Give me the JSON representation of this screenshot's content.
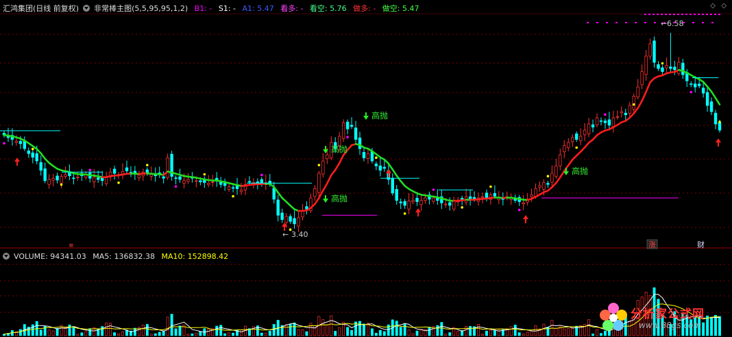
{
  "header": {
    "stock_title": "汇鸿集团(日线 前复权)",
    "indicator_title": "非常棒主图(5,5,95,95,1,2)",
    "b1": "B1: -",
    "s1": "S1: -",
    "a1": "A1: 5.47",
    "kanduo": "看多: -",
    "kankong": "看空: 5.76",
    "zuoduo": "做多: -",
    "zuokong": "做空: 5.47"
  },
  "volume_header": {
    "volume": "VOLUME: 94341.03",
    "ma5": "MA5: 136832.38",
    "ma10": "MA10: 152898.42"
  },
  "annotations": {
    "high_label": "6.58",
    "low_label": "3.40",
    "gaopao": "高抛",
    "zhang_badge": "涨",
    "cai_badge": "财"
  },
  "colors": {
    "up": "#ff3232",
    "down": "#00ffff",
    "line_down": "#22dd22",
    "line_up": "#ff1e1e",
    "grid": "#800000",
    "yellow": "#ffff00",
    "magenta": "#ff00ff"
  },
  "watermark": {
    "text": "分析家公式网",
    "url": "www.88gs.com"
  },
  "chart_data": {
    "type": "candlestick",
    "ylim": [
      3.2,
      6.8
    ],
    "price_high": 6.58,
    "price_low": 3.4,
    "a1": 5.47,
    "closes": [
      4.92,
      4.88,
      4.85,
      4.82,
      4.78,
      4.7,
      4.62,
      4.56,
      4.5,
      4.35,
      4.18,
      4.2,
      4.22,
      4.19,
      4.25,
      4.28,
      4.26,
      4.22,
      4.24,
      4.26,
      4.28,
      4.22,
      4.24,
      4.2,
      4.18,
      4.24,
      4.32,
      4.3,
      4.28,
      4.33,
      4.34,
      4.31,
      4.29,
      4.27,
      4.32,
      4.3,
      4.28,
      4.26,
      4.28,
      4.22,
      4.55,
      4.25,
      4.22,
      4.2,
      4.18,
      4.2,
      4.22,
      4.18,
      4.16,
      4.15,
      4.14,
      4.16,
      4.18,
      4.12,
      4.1,
      4.08,
      4.06,
      4.05,
      4.03,
      4.12,
      4.16,
      4.15,
      4.14,
      4.14,
      4.15,
      4.12,
      3.88,
      3.62,
      3.55,
      3.6,
      3.52,
      3.48,
      3.58,
      3.7,
      3.72,
      3.9,
      4.05,
      4.3,
      4.5,
      4.6,
      4.8,
      4.7,
      4.9,
      5.12,
      5.02,
      5.06,
      4.85,
      4.7,
      4.55,
      4.62,
      4.5,
      4.42,
      4.35,
      4.38,
      4.2,
      3.98,
      3.86,
      3.82,
      3.78,
      3.85,
      3.86,
      3.84,
      3.86,
      3.9,
      3.88,
      3.9,
      3.86,
      3.82,
      3.8,
      3.78,
      3.85,
      3.86,
      3.88,
      3.92,
      3.86,
      3.88,
      3.9,
      3.92,
      3.9,
      3.95,
      3.93,
      3.9,
      3.88,
      3.92,
      3.9,
      3.86,
      3.84,
      3.82,
      3.86,
      3.95,
      4.05,
      4.1,
      4.15,
      4.12,
      4.3,
      4.42,
      4.6,
      4.75,
      4.8,
      4.88,
      4.85,
      4.9,
      5.0,
      5.1,
      5.05,
      5.2,
      5.15,
      5.12,
      5.08,
      5.2,
      5.22,
      5.3,
      5.25,
      5.4,
      5.55,
      5.7,
      5.95,
      6.2,
      6.4,
      6.1,
      6.0,
      5.95,
      6.05,
      6.0,
      5.98,
      6.1,
      5.9,
      5.8,
      5.75,
      5.7,
      5.72,
      5.6,
      5.4,
      5.3,
      5.1,
      5.0
    ],
    "volume_ylim": [
      0,
      1000000
    ],
    "volume_ma5_last": 136832.38,
    "volume_ma10_last": 152898.42,
    "volume_last": 94341.03
  }
}
